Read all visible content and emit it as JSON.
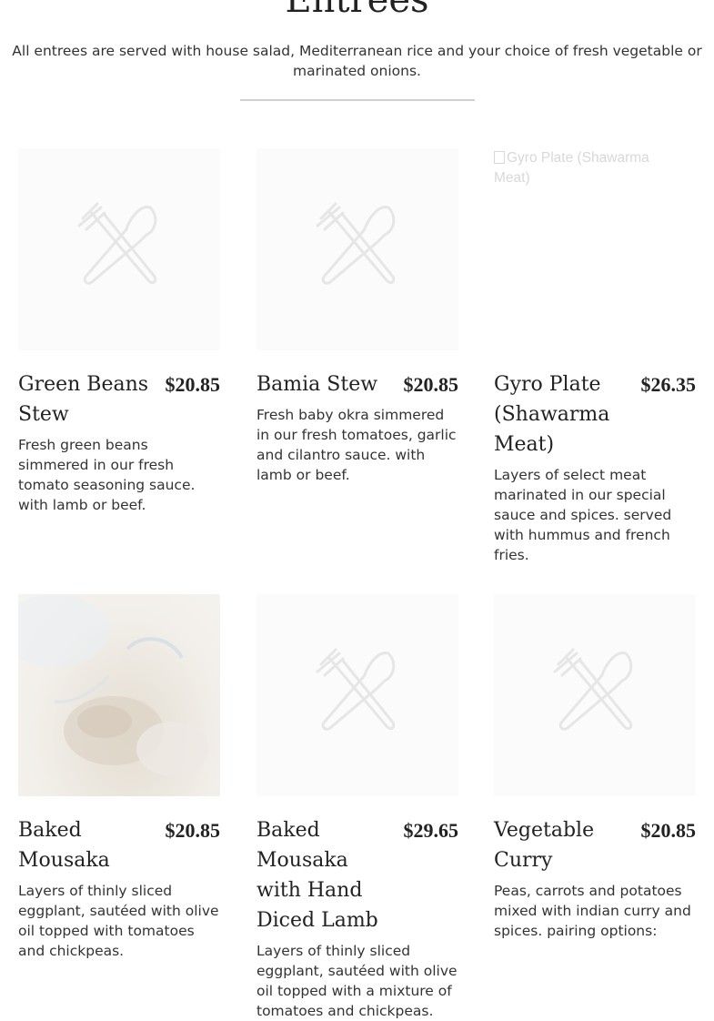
{
  "section": {
    "title": "Entrees",
    "subtitle": "All entrees are served with house salad, Mediterranean rice and your choice of fresh vegetable or marinated onions."
  },
  "items": [
    {
      "name": "Green Beans Stew",
      "price": "$20.85",
      "description": "Fresh green beans simmered in our fresh tomato seasoning sauce. with lamb or beef.",
      "image": "placeholder-cutlery-icon"
    },
    {
      "name": "Bamia Stew",
      "price": "$20.85",
      "description": "Fresh baby okra simmered in our fresh tomatoes, garlic and cilantro sauce. with lamb or beef.",
      "image": "placeholder-cutlery-icon"
    },
    {
      "name": "Gyro Plate (Shawarma Meat)",
      "price": "$26.35",
      "description": "Layers of select meat marinated in our special sauce and spices. served with hummus and french fries.",
      "image": "broken-image-icon",
      "image_alt": "Gyro Plate (Shawarma Meat)"
    },
    {
      "name": "Baked Mousaka",
      "price": "$20.85",
      "description": "Layers of thinly sliced eggplant, sautéed with olive oil topped with tomatoes and chickpeas.",
      "image": "food-photo"
    },
    {
      "name": "Baked Mousaka with Hand Diced Lamb",
      "price": "$29.65",
      "description": "Layers of thinly sliced eggplant, sautéed with olive oil topped with a mixture of tomatoes and chickpeas.",
      "image": "placeholder-cutlery-icon"
    },
    {
      "name": "Vegetable Curry",
      "price": "$20.85",
      "description": "Peas, carrots and potatoes mixed with indian curry and spices. pairing options:",
      "image": "placeholder-cutlery-icon"
    }
  ]
}
